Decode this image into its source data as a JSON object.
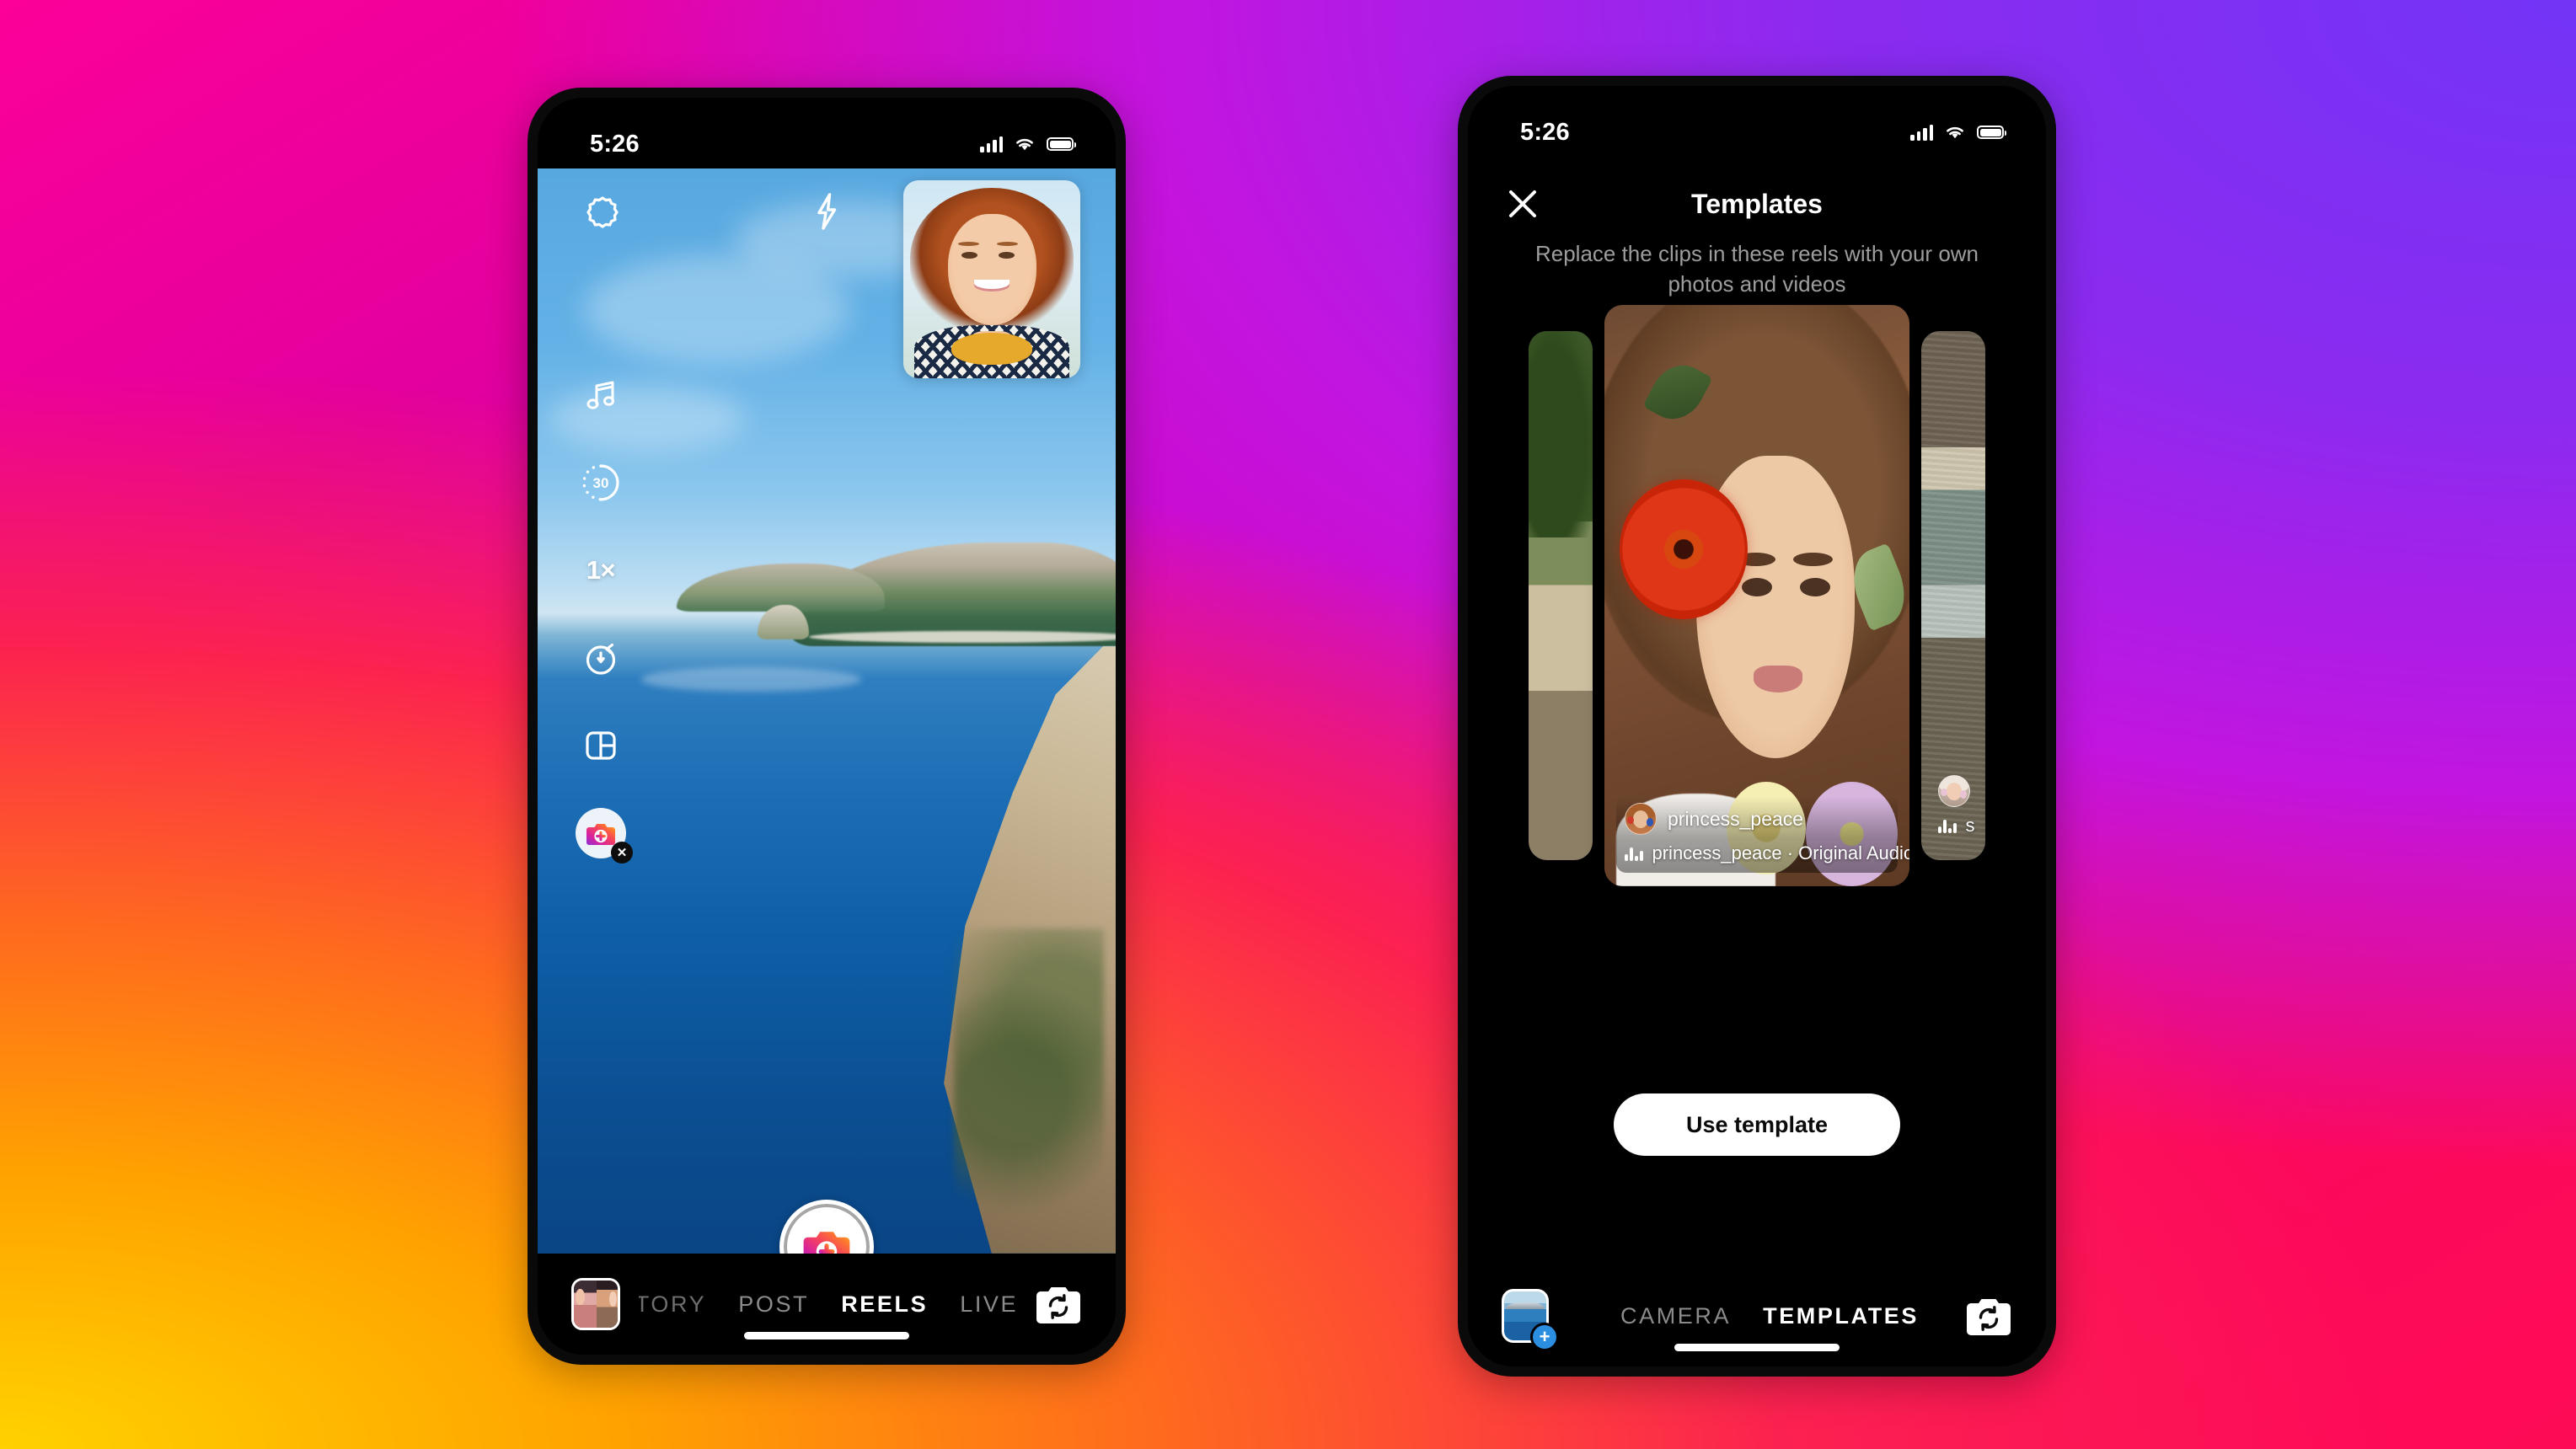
{
  "background": {
    "gradient_colors": [
      "#FC0099",
      "#7334F6",
      "#C215E0",
      "#FB0662",
      "#FF6A1E",
      "#FFD200"
    ]
  },
  "phone_left": {
    "status_bar": {
      "time": "5:26",
      "cellular_icon": "signal-bars-icon",
      "wifi_icon": "wifi-icon",
      "battery_icon": "battery-icon"
    },
    "camera_top": {
      "settings_icon": "gear-icon",
      "flash_icon": "flash-bolt-icon",
      "close_icon": "close-x-icon"
    },
    "side_rail": [
      {
        "name": "audio",
        "icon": "music-note-icon",
        "label": ""
      },
      {
        "name": "length",
        "icon": "timer-dial-icon",
        "label": "30"
      },
      {
        "name": "speed",
        "icon": "speed-icon",
        "label": "1×"
      },
      {
        "name": "timer",
        "icon": "stopwatch-icon",
        "label": ""
      },
      {
        "name": "layout",
        "icon": "grid-layout-icon",
        "label": ""
      },
      {
        "name": "effects",
        "icon": "instagram-camera-effect-icon",
        "label": "",
        "removable": true,
        "remove_icon": "close-x-badge-icon"
      }
    ],
    "shutter": {
      "icon": "instagram-camera-shutter-icon",
      "label": ""
    },
    "pip_preview": {
      "name": "selfie-preview"
    },
    "mode_bar": {
      "gallery_icon": "gallery-thumbnail-icon",
      "modes": [
        {
          "label": "TORY",
          "active": false,
          "clipped": true
        },
        {
          "label": "POST",
          "active": false,
          "clipped": false
        },
        {
          "label": "REELS",
          "active": true,
          "clipped": false
        },
        {
          "label": "LIVE",
          "active": false,
          "clipped": false
        }
      ],
      "flip_icon": "flip-camera-icon"
    }
  },
  "phone_right": {
    "status_bar": {
      "time": "5:26",
      "cellular_icon": "signal-bars-icon",
      "wifi_icon": "wifi-icon",
      "battery_icon": "battery-icon"
    },
    "header": {
      "close_icon": "close-x-icon",
      "title": "Templates",
      "subtitle": "Replace the clips in these reels with your own photos and videos"
    },
    "carousel": {
      "left_card": {
        "username": "",
        "audio": ""
      },
      "main_card": {
        "username": "princess_peace",
        "audio": "princess_peace · Original Audio",
        "audio_icon": "audio-equalizer-icon",
        "avatar": "user-avatar"
      },
      "right_card": {
        "username": "",
        "audio": "s",
        "audio_icon": "audio-equalizer-icon",
        "avatar": "user-avatar"
      }
    },
    "use_template_button": "Use template",
    "mode_bar": {
      "gallery_icon": "gallery-add-thumbnail-icon",
      "plus_badge": "+",
      "modes": [
        {
          "label": "CAMERA",
          "active": false
        },
        {
          "label": "TEMPLATES",
          "active": true
        }
      ],
      "flip_icon": "flip-camera-icon"
    }
  }
}
